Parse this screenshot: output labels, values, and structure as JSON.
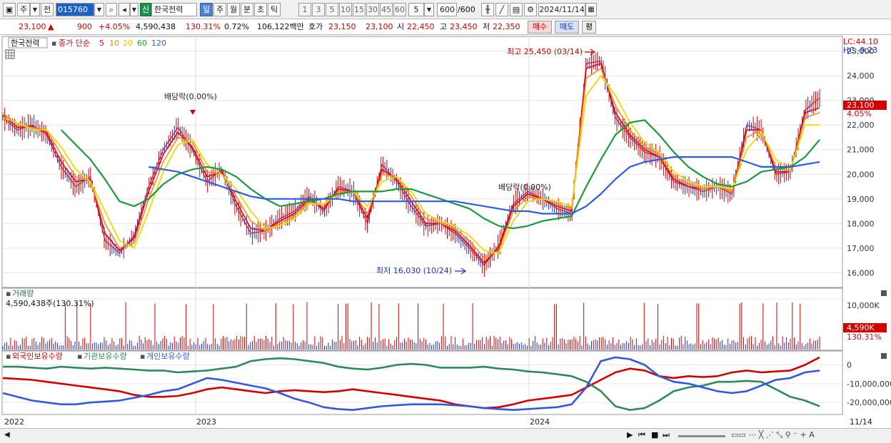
{
  "toolbar": {
    "type_label": "주",
    "prev_label": "전",
    "stock_code": "015760",
    "name_badge": "신",
    "stock_name": "한국전력",
    "periods": [
      "일",
      "주",
      "월",
      "분",
      "초",
      "틱"
    ],
    "selected_period": "일",
    "intervals": [
      "1",
      "3",
      "5",
      "10",
      "15",
      "30",
      "45",
      "60"
    ],
    "count_value": "5",
    "bars_value": "600",
    "bars_total": "/600",
    "date_value": "2024/11/14"
  },
  "quote": {
    "price": "23,100",
    "arrow": "▲",
    "change": "900",
    "change_pct": "+4.05%",
    "volume": "4,590,438",
    "volume_ratio": "130.31%",
    "turnover_rate": "0.72%",
    "amount": "106,122백만",
    "hoga_label": "호가",
    "ask": "23,150",
    "bid": "23,100",
    "open_label": "시",
    "open": "22,450",
    "high_label": "고",
    "high": "23,450",
    "low_label": "저",
    "low": "22,350",
    "buy_label": "매수",
    "sell_label": "매도",
    "eval_label": "평"
  },
  "price_panel": {
    "name_tag": "한국전력",
    "ma_label": "종가 단순",
    "ma_periods": [
      "5",
      "10",
      "20",
      "60",
      "120"
    ],
    "lc": "LC:44.10",
    "hc": "HC:-9.23",
    "y_ticks": [
      "25,000",
      "24,000",
      "23,000",
      "22,000",
      "21,000",
      "20,000",
      "19,000",
      "18,000",
      "17,000",
      "16,000"
    ],
    "current_tag": "23,100",
    "current_pct": "4.05%",
    "dividend_1": "배당락(0.00%)",
    "dividend_2": "배당락(0.00%)",
    "high_note": "최고 25,450 (03/14)",
    "low_note": "최저 16,030 (10/24)"
  },
  "volume_panel": {
    "title": "거래량",
    "value": "4,590,438주(130.31%)",
    "y_tick": "10,000K",
    "current_tag": "4,590K",
    "current_pct": "130.31%"
  },
  "holder_panel": {
    "legend": [
      "외국인보유수량",
      "기관보유수량",
      "개인보유수량"
    ],
    "y_ticks": [
      "0",
      "-10,000,000",
      "-20,000,000"
    ]
  },
  "x_axis": {
    "labels": [
      "2022",
      "2023",
      "2024"
    ],
    "last_date": "11/14"
  },
  "colors": {
    "up": "#d40000",
    "down": "#1a34c8",
    "ma5": "#e0002a",
    "ma10": "#f08c1e",
    "ma20": "#f0d800",
    "ma60": "#1a9a3a",
    "ma120": "#2b5ce6",
    "foreign": "#d40000",
    "institution": "#2d8b57",
    "individual": "#3358e0"
  },
  "chart_data": {
    "type": "line",
    "title": "한국전력",
    "x_labels": [
      "2022",
      "2023",
      "2024",
      "11/14"
    ],
    "price_series": [
      {
        "name": "종가",
        "values": [
          22300,
          21800,
          22000,
          21600,
          20300,
          19500,
          19900,
          17300,
          16800,
          17500,
          19500,
          21000,
          21900,
          21000,
          19700,
          20200,
          18700,
          17600,
          17700,
          18200,
          18500,
          19100,
          18500,
          19500,
          19300,
          18000,
          20400,
          19700,
          18700,
          17900,
          18000,
          17600,
          17000,
          16300,
          17100,
          18800,
          19300,
          19000,
          18600,
          18400,
          24500,
          24600,
          22300,
          21500,
          20900,
          20700,
          19700,
          19500,
          19300,
          19500,
          19200,
          22000,
          21800,
          20000,
          20100,
          22600,
          23100
        ]
      },
      {
        "name": "5",
        "values": [
          22400,
          21900,
          21950,
          21700,
          20500,
          19700,
          19800,
          17600,
          16900,
          17400,
          19300,
          20800,
          21700,
          21100,
          19900,
          20100,
          18900,
          17800,
          17700,
          18100,
          18400,
          19000,
          18600,
          19400,
          19300,
          18200,
          20200,
          19800,
          18900,
          18000,
          18000,
          17700,
          17100,
          16400,
          17000,
          18700,
          19200,
          19000,
          18700,
          18500,
          24300,
          24500,
          22500,
          21600,
          21000,
          20700,
          19800,
          19500,
          19400,
          19500,
          19300,
          21800,
          21800,
          20100,
          20100,
          22500,
          22700
        ]
      },
      {
        "name": "10",
        "values": [
          22500,
          22000,
          21900,
          21800,
          20800,
          19900,
          19700,
          18000,
          17000,
          17200,
          19000,
          20500,
          21500,
          21300,
          20100,
          20000,
          19100,
          18100,
          17700,
          18000,
          18300,
          18900,
          18700,
          19300,
          19300,
          18400,
          20000,
          19900,
          19100,
          18200,
          18000,
          17800,
          17300,
          16600,
          16900,
          18500,
          19100,
          19000,
          18800,
          18600,
          23900,
          24300,
          22800,
          21800,
          21100,
          20800,
          19900,
          19600,
          19400,
          19500,
          19300,
          21500,
          21800,
          20300,
          20100,
          22300,
          22500
        ]
      },
      {
        "name": "20",
        "values": [
          22300,
          22100,
          21800,
          21800,
          21100,
          20200,
          19700,
          18500,
          17300,
          17000,
          18500,
          20100,
          21200,
          21400,
          20400,
          20000,
          19400,
          18500,
          17800,
          17900,
          18200,
          18800,
          18800,
          19200,
          19300,
          18700,
          19700,
          19900,
          19300,
          18400,
          18100,
          17900,
          17500,
          16900,
          16800,
          18100,
          18900,
          19000,
          18900,
          18700,
          23200,
          24000,
          23200,
          22100,
          21300,
          20900,
          20100,
          19700,
          19500,
          19500,
          19400,
          21000,
          21700,
          20600,
          20200,
          22000,
          22000
        ]
      },
      {
        "name": "60",
        "values": [
          null,
          null,
          null,
          null,
          21800,
          21200,
          20600,
          19800,
          18900,
          18700,
          19000,
          19600,
          20000,
          20200,
          20300,
          20200,
          19900,
          19400,
          19000,
          18700,
          18800,
          18900,
          19000,
          19200,
          19300,
          19300,
          19300,
          19400,
          19400,
          19200,
          19000,
          18800,
          18600,
          18200,
          17900,
          17800,
          17900,
          18100,
          18200,
          18300,
          19500,
          20600,
          21600,
          22100,
          22200,
          21600,
          20900,
          20300,
          19900,
          19600,
          19500,
          19700,
          20100,
          20200,
          20300,
          20700,
          21400
        ]
      },
      {
        "name": "120",
        "values": [
          null,
          null,
          null,
          null,
          null,
          null,
          null,
          null,
          null,
          null,
          20300,
          20200,
          20100,
          19900,
          19700,
          19500,
          19300,
          19100,
          19000,
          19000,
          19000,
          19000,
          19000,
          19000,
          18900,
          18900,
          18900,
          18900,
          18900,
          18900,
          18900,
          18900,
          18800,
          18700,
          18600,
          18500,
          18500,
          18400,
          18400,
          18400,
          18700,
          19200,
          19800,
          20300,
          20500,
          20600,
          20700,
          20700,
          20700,
          20700,
          20700,
          20500,
          20300,
          20300,
          20300,
          20400,
          20500
        ]
      }
    ],
    "volume_scale_max": 10000,
    "holder_series": [
      {
        "name": "외국인보유수량",
        "values": [
          -7000000,
          -7500000,
          -8000000,
          -9000000,
          -10000000,
          -11000000,
          -12000000,
          -13000000,
          -14000000,
          -16000000,
          -17000000,
          -17000000,
          -16500000,
          -15000000,
          -13000000,
          -12000000,
          -13000000,
          -14000000,
          -15000000,
          -14000000,
          -13500000,
          -14000000,
          -14500000,
          -14000000,
          -13000000,
          -14000000,
          -15000000,
          -16000000,
          -17000000,
          -18000000,
          -19000000,
          -21000000,
          -22000000,
          -23000000,
          -22500000,
          -21000000,
          -19000000,
          -18000000,
          -17000000,
          -16000000,
          -12000000,
          -8000000,
          -4000000,
          -2000000,
          -3000000,
          -6000000,
          -7000000,
          -6000000,
          -6500000,
          -6000000,
          -4000000,
          -3000000,
          -4000000,
          -3500000,
          -3000000,
          0,
          4000000
        ]
      },
      {
        "name": "기관보유수량",
        "values": [
          -1000000,
          -1000000,
          -1500000,
          -2000000,
          -1000000,
          -1500000,
          -2000000,
          -1500000,
          -2000000,
          -2500000,
          -3000000,
          -3000000,
          -4000000,
          -3500000,
          -3000000,
          -2000000,
          -1000000,
          2000000,
          3000000,
          3500000,
          3000000,
          2000000,
          1000000,
          -1000000,
          -2000000,
          -2500000,
          -1500000,
          0,
          500000,
          0,
          -1500000,
          -1500000,
          -1500000,
          -1000000,
          -2000000,
          -2500000,
          -3500000,
          -4000000,
          -5000000,
          -6000000,
          -9000000,
          -14000000,
          -22000000,
          -24000000,
          -23000000,
          -19000000,
          -14000000,
          -12000000,
          -11000000,
          -9000000,
          -9000000,
          -8500000,
          -9000000,
          -13000000,
          -17000000,
          -19000000,
          -22000000
        ]
      },
      {
        "name": "개인보유수량",
        "values": [
          -15000000,
          -17000000,
          -19000000,
          -20000000,
          -21000000,
          -21000000,
          -20000000,
          -19500000,
          -19000000,
          -17500000,
          -16000000,
          -14000000,
          -13000000,
          -10000000,
          -7000000,
          -8000000,
          -9500000,
          -11000000,
          -12500000,
          -15000000,
          -18000000,
          -20000000,
          -22500000,
          -23500000,
          -24000000,
          -23000000,
          -22000000,
          -21500000,
          -21000000,
          -21000000,
          -21000000,
          -21500000,
          -22000000,
          -23000000,
          -23500000,
          -24000000,
          -23500000,
          -23000000,
          -22500000,
          -21000000,
          -12000000,
          2000000,
          4000000,
          3000000,
          0,
          -6000000,
          -9000000,
          -10000000,
          -12000000,
          -14000000,
          -15000000,
          -14000000,
          -11000000,
          -8000000,
          -7000000,
          -4000000,
          -3000000
        ]
      }
    ]
  }
}
